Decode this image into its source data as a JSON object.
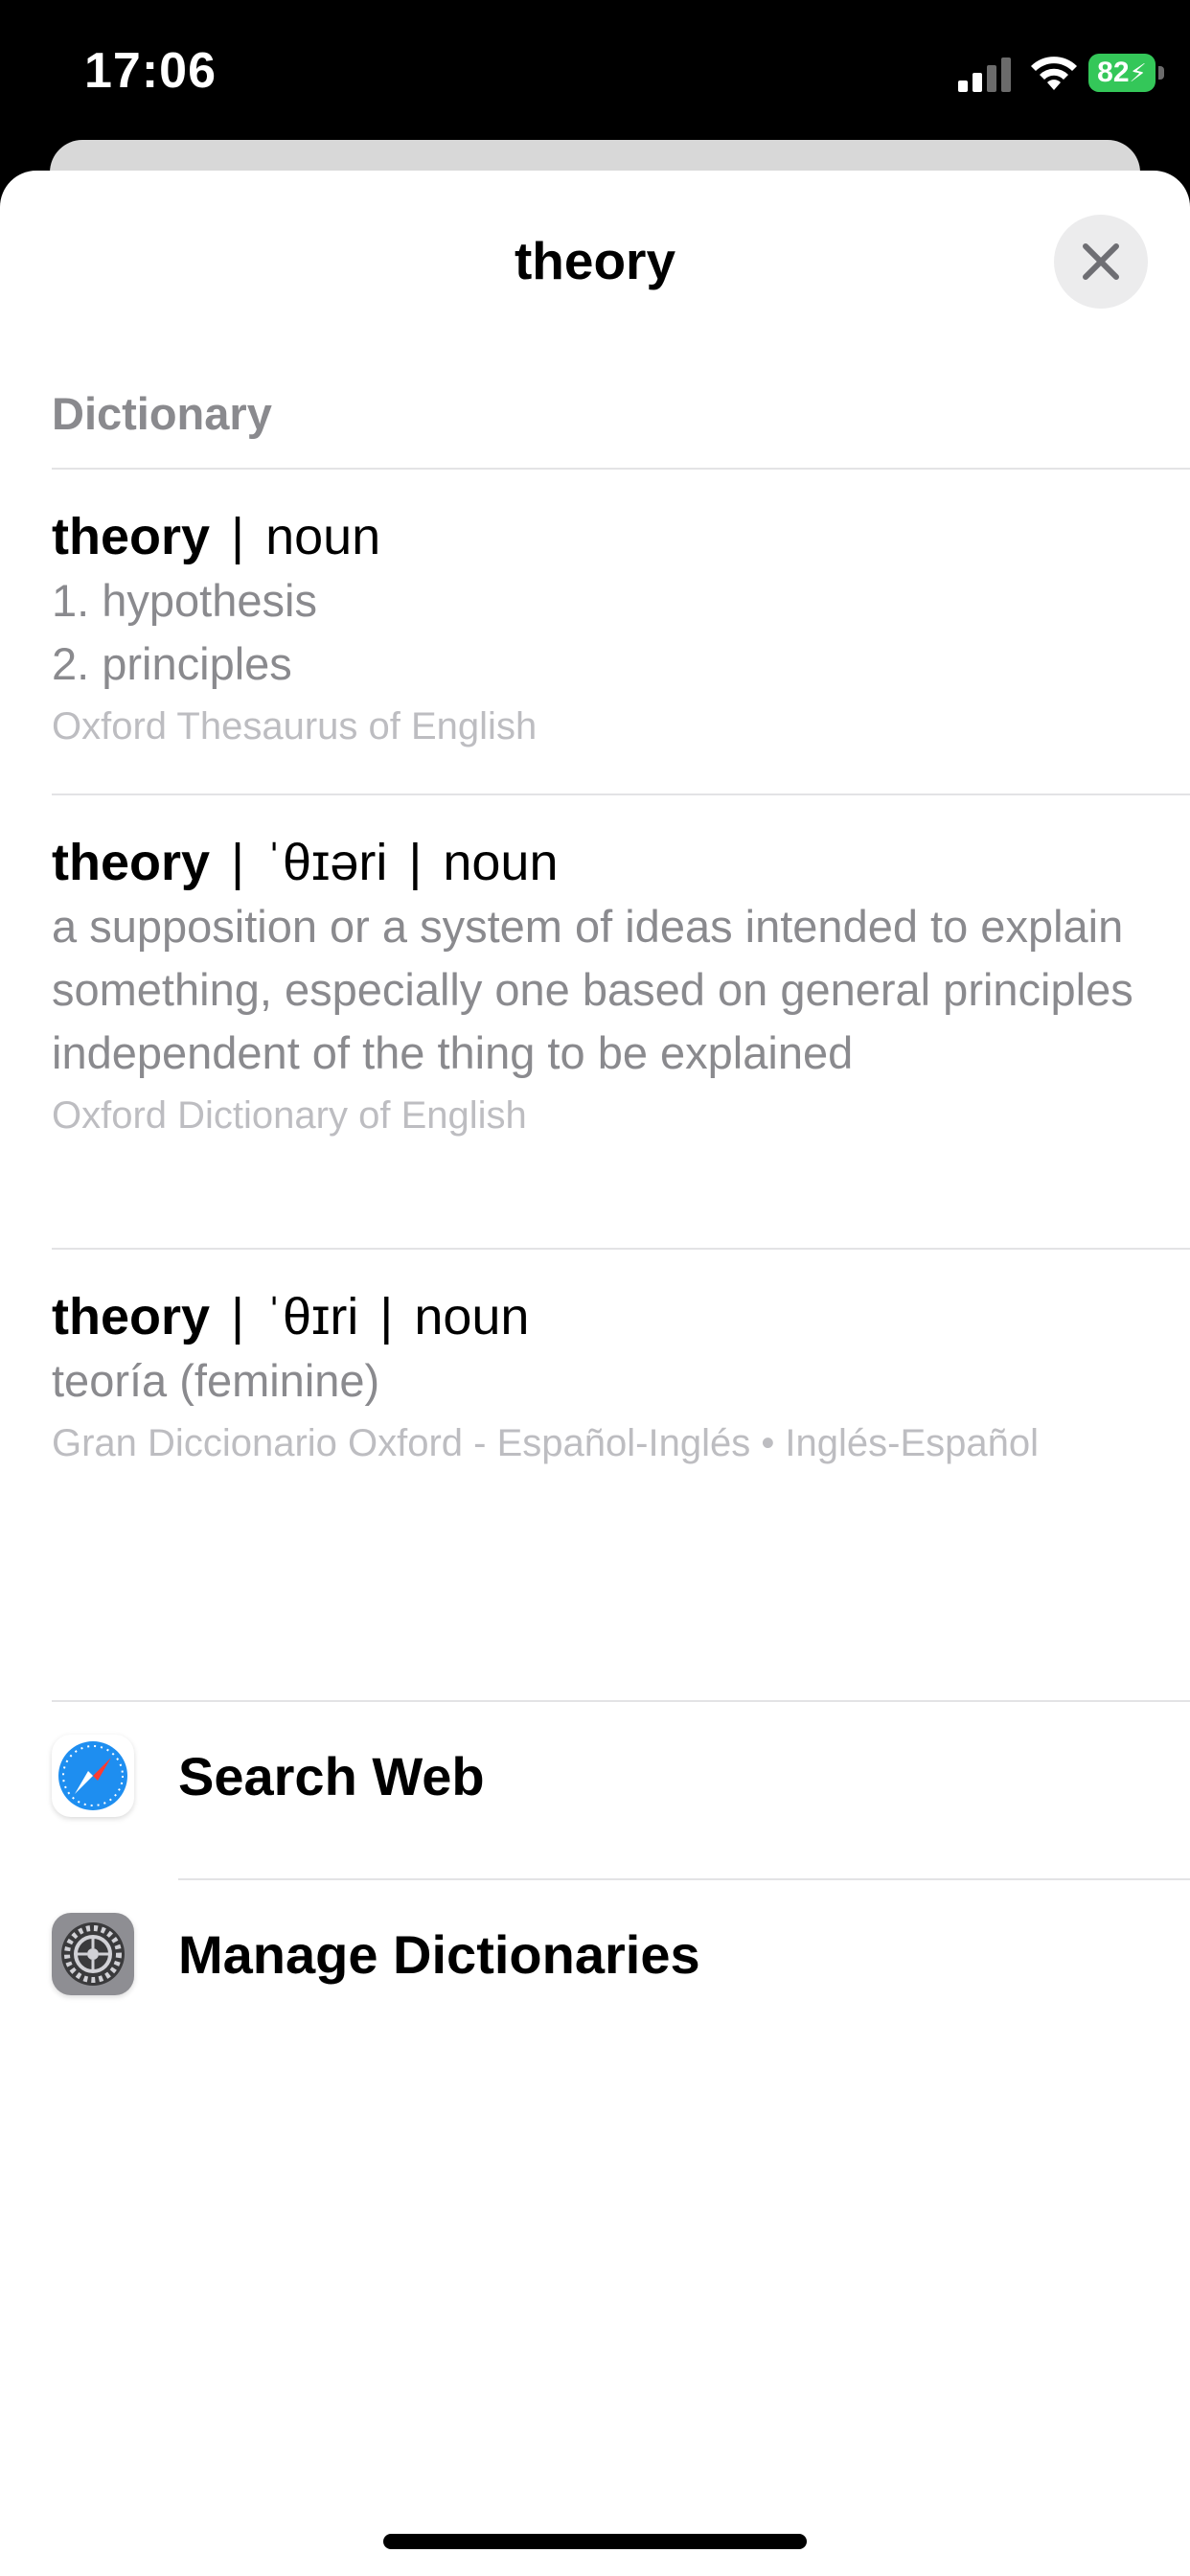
{
  "status_bar": {
    "time": "17:06",
    "battery_level": "82",
    "battery_color": "#34c759",
    "icons": [
      "cellular-signal-icon",
      "wifi-icon",
      "battery-charging-icon"
    ]
  },
  "sheet": {
    "title": "theory",
    "close_icon": "close-icon"
  },
  "dictionary": {
    "section_title": "Dictionary",
    "entries": [
      {
        "headword": "theory",
        "meta": [
          "noun"
        ],
        "definitions": [
          "1. hypothesis",
          "2. principles"
        ],
        "source": "Oxford Thesaurus of English"
      },
      {
        "headword": "theory",
        "meta": [
          "ˈθɪəri",
          "noun"
        ],
        "definitions": [
          "a supposition or a system of ideas intended to explain something, especially one based on general principles independent of the thing to be explained"
        ],
        "source": "Oxford Dictionary of English"
      },
      {
        "headword": "theory",
        "meta": [
          "ˈθɪri",
          "noun"
        ],
        "definitions": [
          "teoría (feminine)"
        ],
        "source": "Gran Diccionario Oxford - Español-Inglés • Inglés-Español"
      }
    ]
  },
  "actions": [
    {
      "label": "Search Web",
      "icon": "safari-icon"
    },
    {
      "label": "Manage Dictionaries",
      "icon": "settings-gear-icon"
    }
  ]
}
